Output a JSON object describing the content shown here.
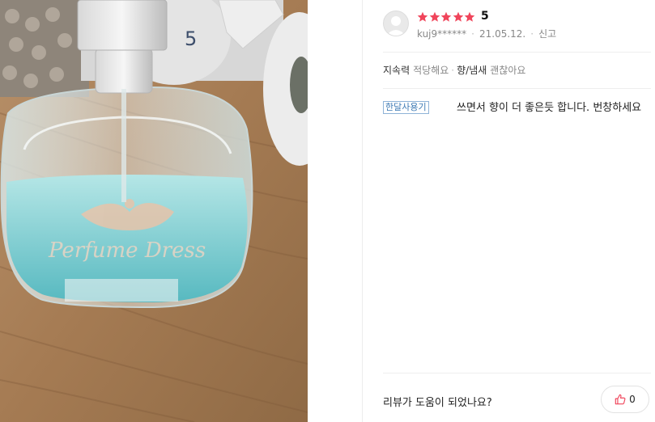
{
  "review": {
    "rating": 5,
    "rating_text": "5",
    "author": "kuj9******",
    "date": "21.05.12.",
    "separator": "·",
    "report_label": "신고",
    "attributes": [
      {
        "key": "지속력",
        "value": "적당해요"
      },
      {
        "key": "향/냄새",
        "value": "괜찮아요"
      }
    ],
    "badge": "한달사용기",
    "text": "쓰면서 향이 더 좋은듯 합니다. 번창하세요",
    "helpful_question": "리뷰가 도움이 되었나요?",
    "helpful_count": "0"
  },
  "photo": {
    "subject": "perfume-bottle-on-wooden-table",
    "bottle_text": "Perfume Dress"
  },
  "colors": {
    "star": "#f0455b",
    "badge_text": "#3e7ab4",
    "like_icon": "#f0455b"
  },
  "icons": {
    "avatar": "default-user-avatar-icon",
    "star": "star-icon",
    "like": "thumbs-up-icon"
  }
}
